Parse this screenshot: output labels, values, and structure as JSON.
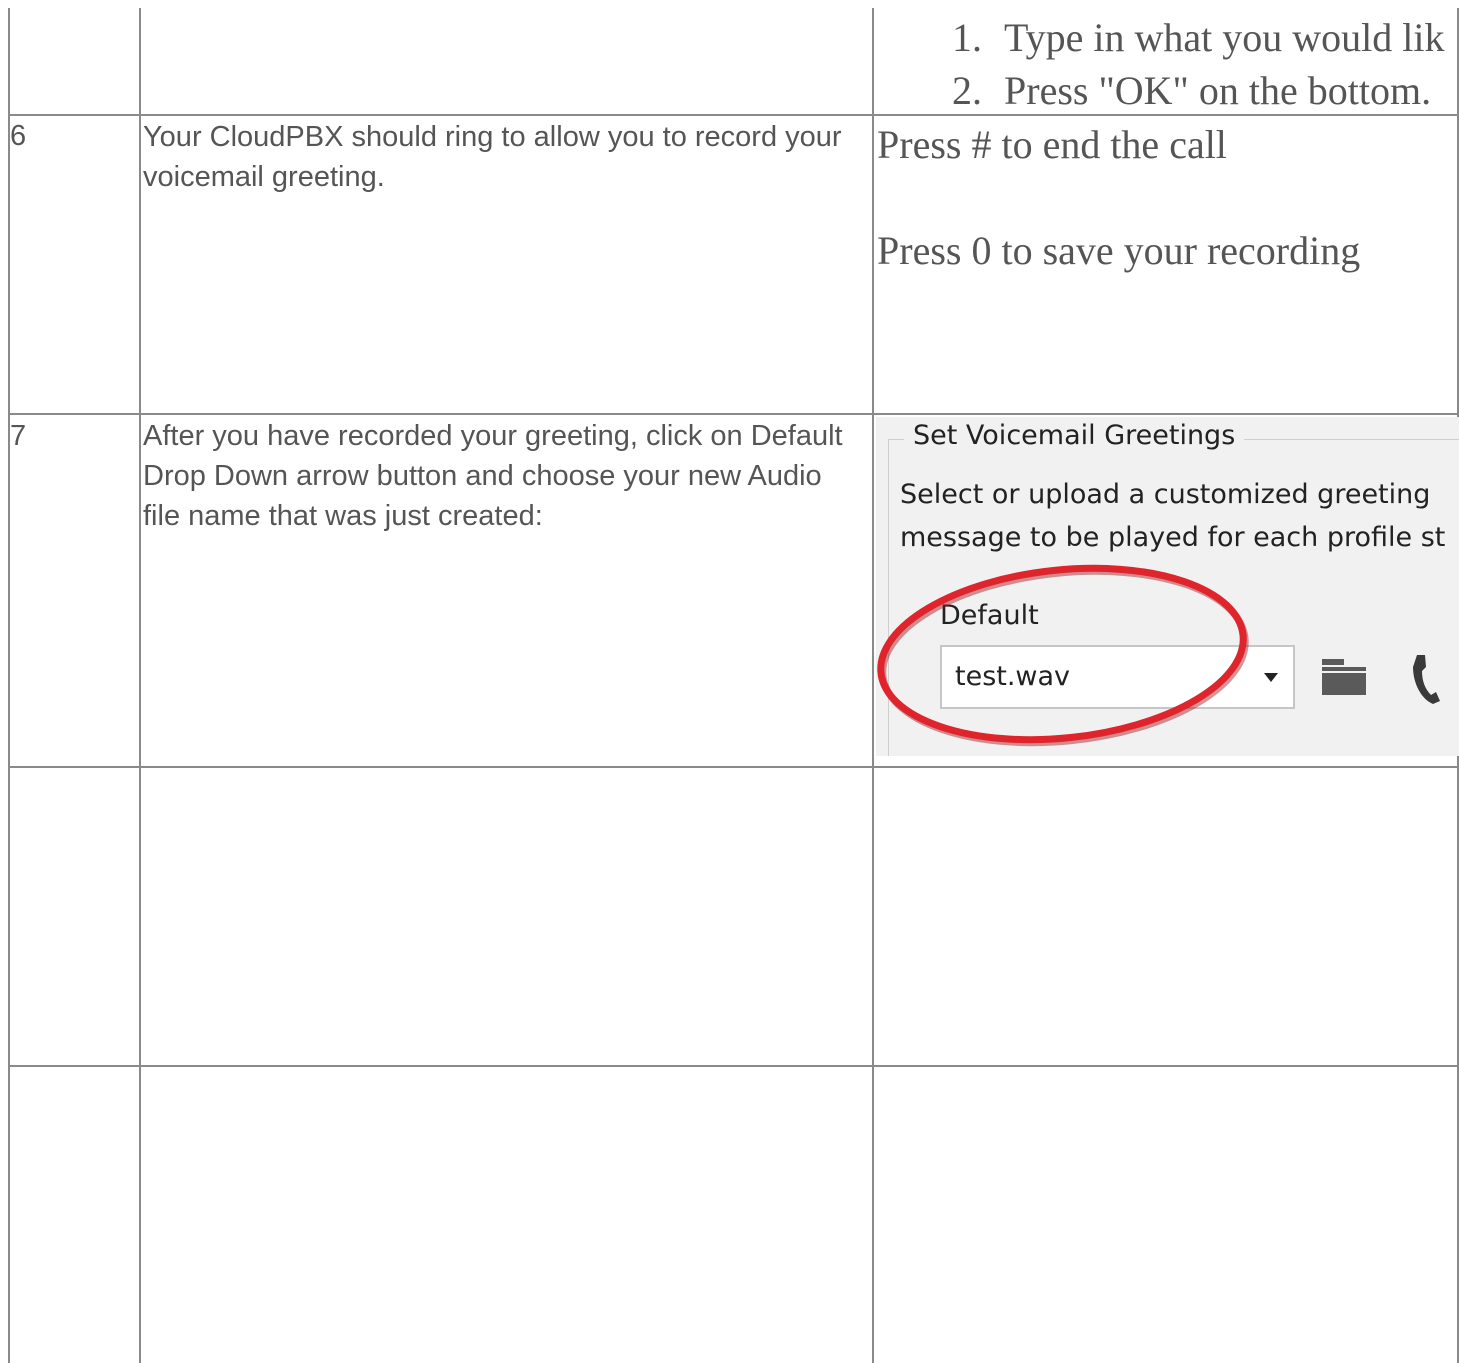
{
  "rows": [
    {
      "step": "",
      "description": "",
      "detail_list": [
        {
          "num": "1.",
          "text": "Type in what you would lik"
        },
        {
          "num": "2.",
          "text": "Press \"OK\" on the bottom."
        }
      ]
    },
    {
      "step": "6",
      "description": "Your CloudPBX should ring to allow you to record your voicemail greeting.",
      "detail_lines": [
        "Press # to end the call",
        "Press 0 to save your recording"
      ]
    },
    {
      "step": "7",
      "description": "After you have recorded your greeting, click on Default Drop Down arrow button and choose your new Audio file name that was just created:",
      "screenshot": {
        "legend": "Set Voicemail Greetings",
        "desc_line1": "Select or upload a customized greeting",
        "desc_line2": "message to be played for each profile st",
        "dropdown_label": "Default",
        "dropdown_value": "test.wav",
        "icons": [
          "dropdown-arrow-icon",
          "folder-icon",
          "phone-icon"
        ],
        "highlight_color": "#e0242b"
      }
    },
    {
      "step": "",
      "description": ""
    },
    {
      "step": "",
      "description": ""
    }
  ]
}
